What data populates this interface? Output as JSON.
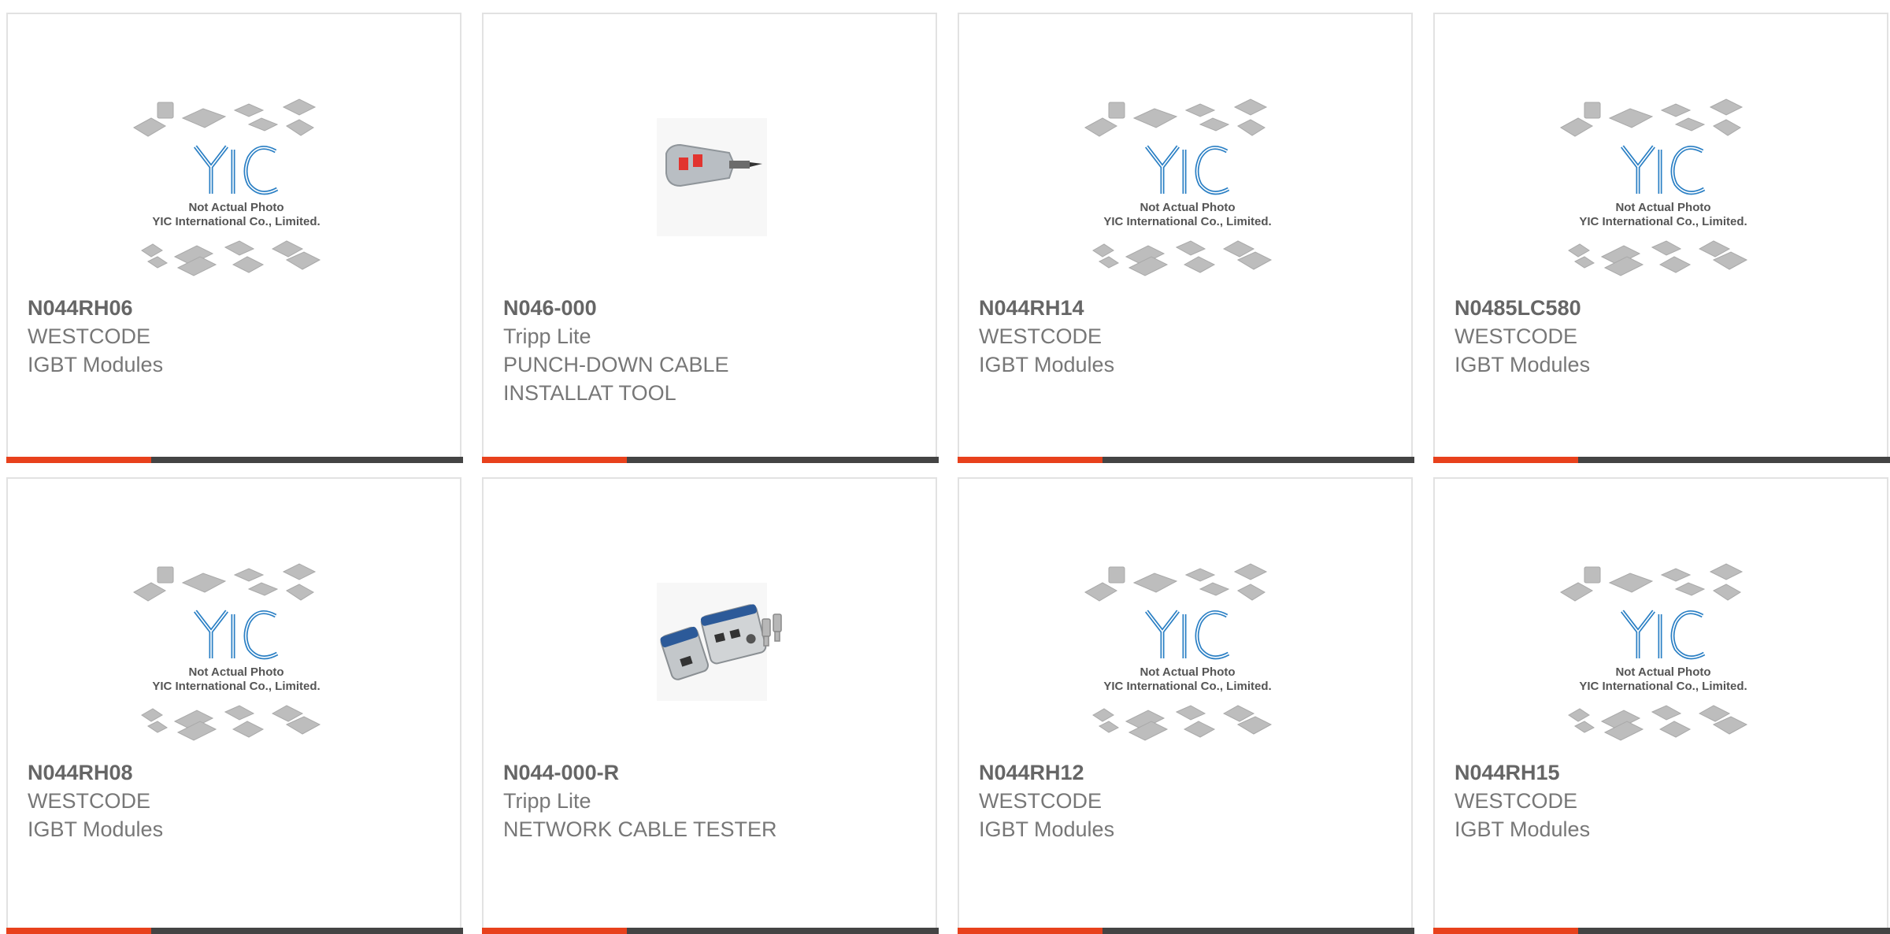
{
  "colors": {
    "accent_orange": "#e8411c",
    "accent_dark": "#444444",
    "logo_blue": "#2a7fc4",
    "border": "#e2e2e2"
  },
  "placeholder_image": {
    "caption_line1": "Not Actual Photo",
    "caption_line2": "YIC International Co., Limited.",
    "logo_text": "YIC"
  },
  "products": [
    {
      "part": "N044RH06",
      "brand": "WESTCODE",
      "desc": [
        "IGBT Modules"
      ],
      "image": "placeholder"
    },
    {
      "part": "N046-000",
      "brand": "Tripp Lite",
      "desc": [
        "PUNCH-DOWN CABLE",
        "INSTALLAT TOOL"
      ],
      "image": "punch-down-tool"
    },
    {
      "part": "N044RH14",
      "brand": "WESTCODE",
      "desc": [
        "IGBT Modules"
      ],
      "image": "placeholder"
    },
    {
      "part": "N0485LC580",
      "brand": "WESTCODE",
      "desc": [
        "IGBT Modules"
      ],
      "image": "placeholder"
    },
    {
      "part": "N044RH08",
      "brand": "WESTCODE",
      "desc": [
        "IGBT Modules"
      ],
      "image": "placeholder"
    },
    {
      "part": "N044-000-R",
      "brand": "Tripp Lite",
      "desc": [
        "NETWORK CABLE TESTER"
      ],
      "image": "cable-tester"
    },
    {
      "part": "N044RH12",
      "brand": "WESTCODE",
      "desc": [
        "IGBT Modules"
      ],
      "image": "placeholder"
    },
    {
      "part": "N044RH15",
      "brand": "WESTCODE",
      "desc": [
        "IGBT Modules"
      ],
      "image": "placeholder"
    }
  ]
}
